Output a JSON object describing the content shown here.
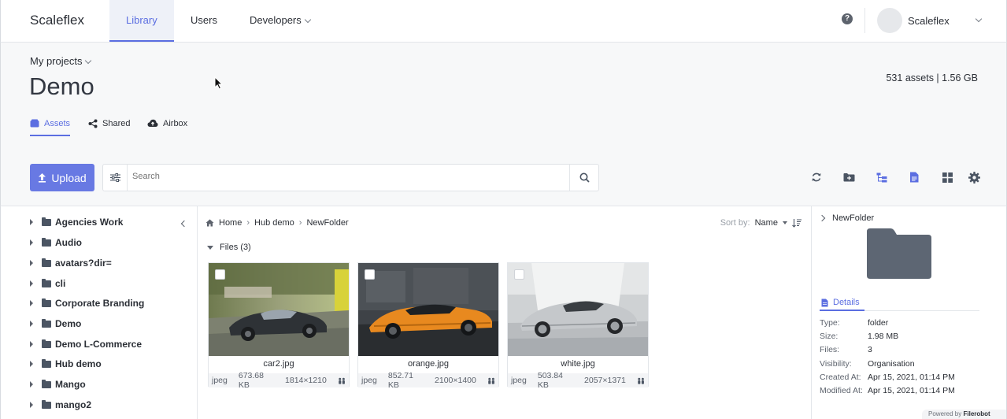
{
  "nav": {
    "brand": "Scaleflex",
    "tabs": [
      "Library",
      "Users",
      "Developers"
    ],
    "help": "?",
    "user_name": "Scaleflex"
  },
  "header": {
    "breadcrumb": "My projects",
    "title": "Demo",
    "stats": "531 assets | 1.56 GB",
    "subtabs": [
      "Assets",
      "Shared",
      "Airbox"
    ]
  },
  "toolbar": {
    "upload_label": "Upload",
    "search_placeholder": "Search"
  },
  "sidebar": {
    "folders": [
      "Agencies Work",
      "Audio",
      "avatars?dir=",
      "cli",
      "Corporate Branding",
      "Demo",
      "Demo L-Commerce",
      "Hub demo",
      "Mango",
      "mango2"
    ]
  },
  "main": {
    "breadcrumbs": [
      "Home",
      "Hub demo",
      "NewFolder"
    ],
    "sort_label": "Sort by:",
    "sort_value": "Name",
    "files_header": "Files (3)",
    "files": [
      {
        "name": "car2.jpg",
        "type": "jpeg",
        "size": "673.68 KB",
        "dims": "1814×1210"
      },
      {
        "name": "orange.jpg",
        "type": "jpeg",
        "size": "852.71 KB",
        "dims": "2100×1400"
      },
      {
        "name": "white.jpg",
        "type": "jpeg",
        "size": "503.84 KB",
        "dims": "2057×1371"
      }
    ]
  },
  "details": {
    "title": "NewFolder",
    "tab": "Details",
    "rows": [
      {
        "key": "Type:",
        "value": "folder"
      },
      {
        "key": "Size:",
        "value": "1.98 MB"
      },
      {
        "key": "Files:",
        "value": "3"
      },
      {
        "key": "Visibility:",
        "value": "Organisation"
      },
      {
        "key": "Created At:",
        "value": "Apr 15, 2021, 01:14 PM"
      },
      {
        "key": "Modified At:",
        "value": "Apr 15, 2021, 01:14 PM"
      }
    ],
    "powered_prefix": "Powered by",
    "powered_brand": "Filerobot"
  },
  "colors": {
    "accent": "#5b6ee1",
    "upload": "#6879e3",
    "folder": "#4b5563"
  }
}
